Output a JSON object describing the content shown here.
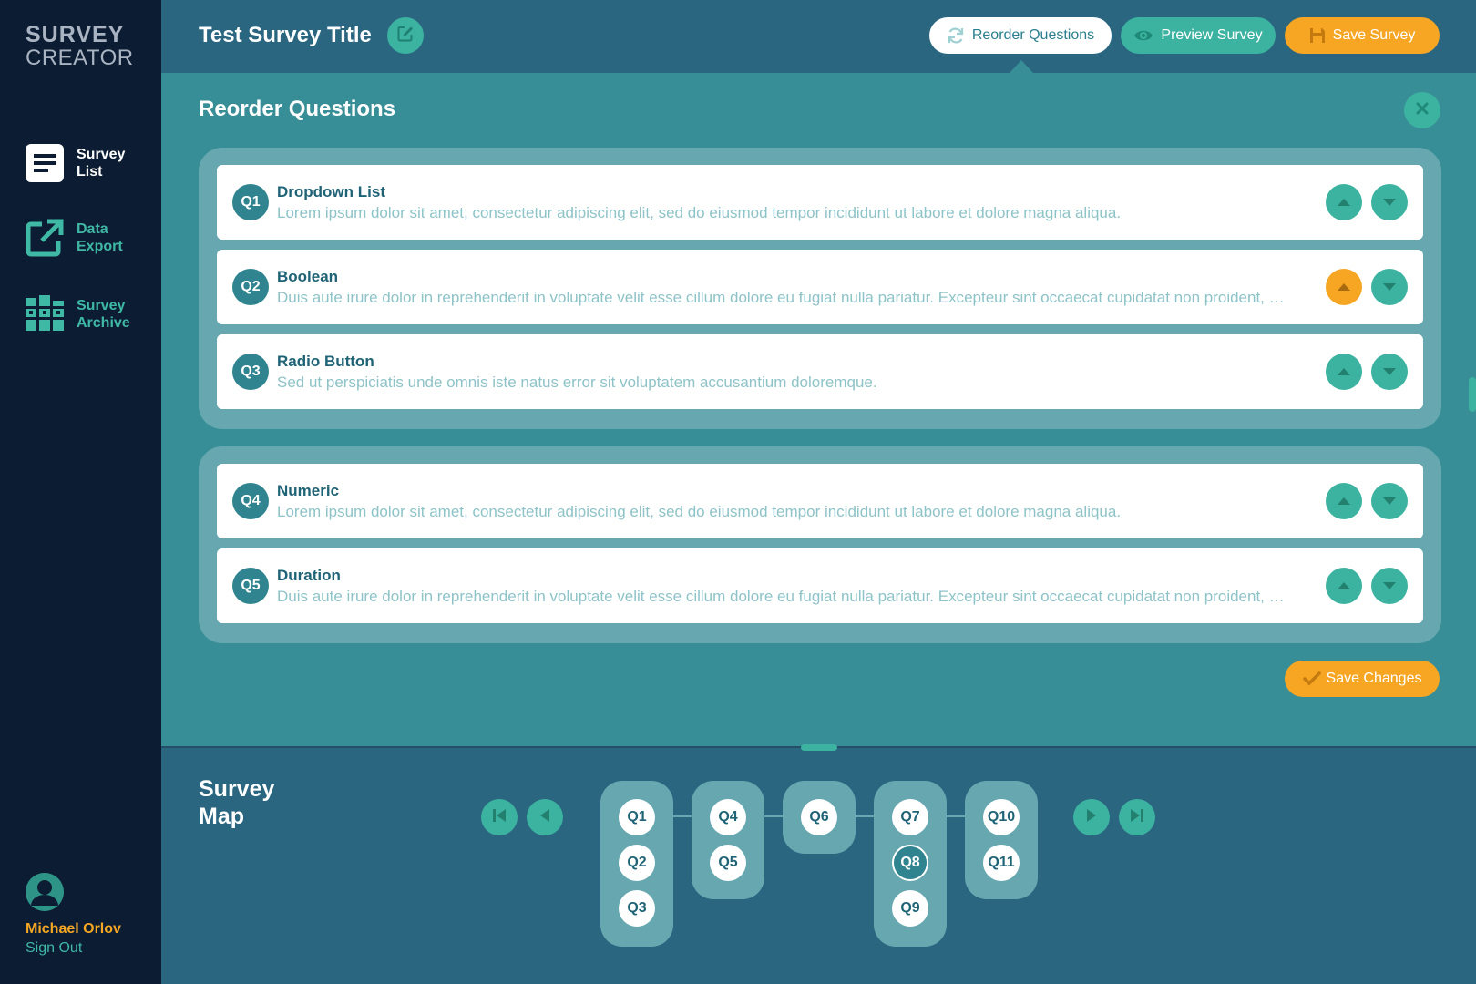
{
  "app": {
    "logo_line1": "SURVEY",
    "logo_line2": "CREATOR"
  },
  "sidebar": {
    "items": [
      {
        "label": "Survey\nList",
        "icon": "list-icon",
        "active": true
      },
      {
        "label": "Data\nExport",
        "icon": "export-icon",
        "active": false
      },
      {
        "label": "Survey\nArchive",
        "icon": "archive-icon",
        "active": false
      }
    ],
    "user_name": "Michael Orlov",
    "sign_out": "Sign Out"
  },
  "header": {
    "title": "Test Survey Title",
    "reorder_label": "Reorder Questions",
    "preview_label": "Preview Survey",
    "save_label": "Save Survey"
  },
  "panel": {
    "title": "Reorder Questions",
    "save_changes_label": "Save Changes",
    "questions": [
      {
        "num": "Q1",
        "title": "Dropdown List",
        "desc": "Lorem ipsum dolor sit amet, consectetur adipiscing elit, sed do eiusmod tempor incididunt ut labore et dolore magna aliqua."
      },
      {
        "num": "Q2",
        "title": "Boolean",
        "desc": "Duis aute irure dolor in reprehenderit in voluptate velit esse cillum dolore eu fugiat nulla pariatur. Excepteur sint occaecat cupidatat non proident, sunt in culpa qui officia deserunt mollit anim id est laborum."
      },
      {
        "num": "Q3",
        "title": "Radio Button",
        "desc": "Sed ut perspiciatis unde omnis iste natus error sit voluptatem accusantium doloremque."
      },
      {
        "num": "Q4",
        "title": "Numeric",
        "desc": "Lorem ipsum dolor sit amet, consectetur adipiscing elit, sed do eiusmod tempor incididunt ut labore et dolore magna aliqua."
      },
      {
        "num": "Q5",
        "title": "Duration",
        "desc": "Duis aute irure dolor in reprehenderit in voluptate velit esse cillum dolore eu fugiat nulla pariatur. Excepteur sint occaecat cupidatat non proident, sunt in culpa qui officia deserunt mollit anim id est laborum."
      }
    ]
  },
  "map": {
    "title": "Survey Map",
    "groups": [
      [
        "Q1",
        "Q2",
        "Q3"
      ],
      [
        "Q4",
        "Q5"
      ],
      [
        "Q6"
      ],
      [
        "Q7",
        "Q8",
        "Q9"
      ],
      [
        "Q10",
        "Q11"
      ]
    ],
    "selected": "Q8"
  },
  "colors": {
    "accent": "#3bb3a0",
    "orange": "#f6a623",
    "sidebar": "#0b1c33",
    "panel": "#388e96"
  }
}
